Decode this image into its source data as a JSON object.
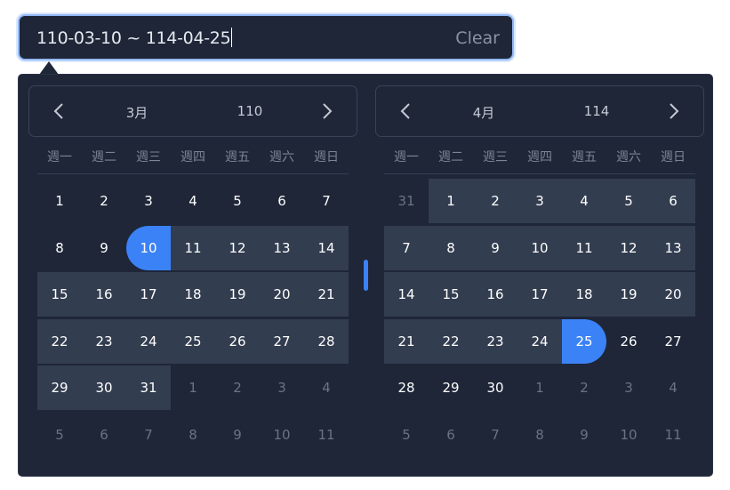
{
  "input": {
    "value": "110-03-10 ~ 114-04-25",
    "clear_label": "Clear"
  },
  "weekdays": [
    "週一",
    "週二",
    "週三",
    "週四",
    "週五",
    "週六",
    "週日"
  ],
  "left": {
    "month": "3月",
    "year": "110",
    "weeks": [
      [
        {
          "d": "1"
        },
        {
          "d": "2"
        },
        {
          "d": "3"
        },
        {
          "d": "4"
        },
        {
          "d": "5"
        },
        {
          "d": "6"
        },
        {
          "d": "7"
        }
      ],
      [
        {
          "d": "8"
        },
        {
          "d": "9"
        },
        {
          "d": "10",
          "s": "start"
        },
        {
          "d": "11",
          "s": "range"
        },
        {
          "d": "12",
          "s": "range"
        },
        {
          "d": "13",
          "s": "range"
        },
        {
          "d": "14",
          "s": "range"
        }
      ],
      [
        {
          "d": "15",
          "s": "range"
        },
        {
          "d": "16",
          "s": "range"
        },
        {
          "d": "17",
          "s": "range"
        },
        {
          "d": "18",
          "s": "range"
        },
        {
          "d": "19",
          "s": "range"
        },
        {
          "d": "20",
          "s": "range"
        },
        {
          "d": "21",
          "s": "range"
        }
      ],
      [
        {
          "d": "22",
          "s": "range"
        },
        {
          "d": "23",
          "s": "range"
        },
        {
          "d": "24",
          "s": "range"
        },
        {
          "d": "25",
          "s": "range"
        },
        {
          "d": "26",
          "s": "range"
        },
        {
          "d": "27",
          "s": "range"
        },
        {
          "d": "28",
          "s": "range"
        }
      ],
      [
        {
          "d": "29",
          "s": "range"
        },
        {
          "d": "30",
          "s": "range"
        },
        {
          "d": "31",
          "s": "range"
        },
        {
          "d": "1",
          "s": "muted"
        },
        {
          "d": "2",
          "s": "muted"
        },
        {
          "d": "3",
          "s": "muted"
        },
        {
          "d": "4",
          "s": "muted"
        }
      ],
      [
        {
          "d": "5",
          "s": "muted"
        },
        {
          "d": "6",
          "s": "muted"
        },
        {
          "d": "7",
          "s": "muted"
        },
        {
          "d": "8",
          "s": "muted"
        },
        {
          "d": "9",
          "s": "muted"
        },
        {
          "d": "10",
          "s": "muted"
        },
        {
          "d": "11",
          "s": "muted"
        }
      ]
    ]
  },
  "right": {
    "month": "4月",
    "year": "114",
    "weeks": [
      [
        {
          "d": "31",
          "s": "muted"
        },
        {
          "d": "1",
          "s": "range"
        },
        {
          "d": "2",
          "s": "range"
        },
        {
          "d": "3",
          "s": "range"
        },
        {
          "d": "4",
          "s": "range"
        },
        {
          "d": "5",
          "s": "range"
        },
        {
          "d": "6",
          "s": "range"
        }
      ],
      [
        {
          "d": "7",
          "s": "range"
        },
        {
          "d": "8",
          "s": "range"
        },
        {
          "d": "9",
          "s": "range"
        },
        {
          "d": "10",
          "s": "range"
        },
        {
          "d": "11",
          "s": "range"
        },
        {
          "d": "12",
          "s": "range"
        },
        {
          "d": "13",
          "s": "range"
        }
      ],
      [
        {
          "d": "14",
          "s": "range"
        },
        {
          "d": "15",
          "s": "range"
        },
        {
          "d": "16",
          "s": "range"
        },
        {
          "d": "17",
          "s": "range"
        },
        {
          "d": "18",
          "s": "range"
        },
        {
          "d": "19",
          "s": "range"
        },
        {
          "d": "20",
          "s": "range"
        }
      ],
      [
        {
          "d": "21",
          "s": "range"
        },
        {
          "d": "22",
          "s": "range"
        },
        {
          "d": "23",
          "s": "range"
        },
        {
          "d": "24",
          "s": "range"
        },
        {
          "d": "25",
          "s": "end"
        },
        {
          "d": "26"
        },
        {
          "d": "27"
        }
      ],
      [
        {
          "d": "28"
        },
        {
          "d": "29"
        },
        {
          "d": "30"
        },
        {
          "d": "1",
          "s": "muted"
        },
        {
          "d": "2",
          "s": "muted"
        },
        {
          "d": "3",
          "s": "muted"
        },
        {
          "d": "4",
          "s": "muted"
        }
      ],
      [
        {
          "d": "5",
          "s": "muted"
        },
        {
          "d": "6",
          "s": "muted"
        },
        {
          "d": "7",
          "s": "muted"
        },
        {
          "d": "8",
          "s": "muted"
        },
        {
          "d": "9",
          "s": "muted"
        },
        {
          "d": "10",
          "s": "muted"
        },
        {
          "d": "11",
          "s": "muted"
        }
      ]
    ]
  },
  "colors": {
    "accent": "#3b82f6",
    "range": "#333d50",
    "panel": "#1e2638"
  },
  "icons": {
    "prev": "chevron-left-icon",
    "next": "chevron-right-icon"
  }
}
